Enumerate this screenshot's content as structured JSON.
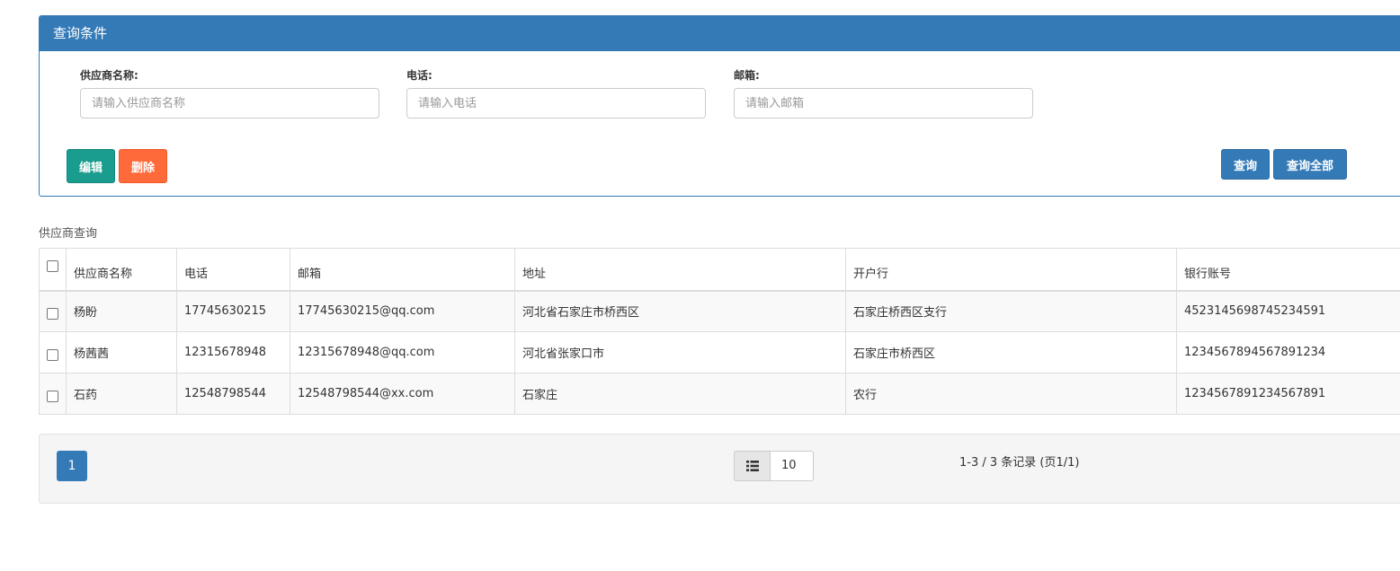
{
  "panel": {
    "title": "查询条件",
    "fields": [
      {
        "label": "供应商名称:",
        "placeholder": "请输入供应商名称",
        "value": ""
      },
      {
        "label": "电话:",
        "placeholder": "请输入电话",
        "value": ""
      },
      {
        "label": "邮箱:",
        "placeholder": "请输入邮箱",
        "value": ""
      }
    ],
    "buttons": {
      "edit": "编辑",
      "delete": "删除",
      "query": "查询",
      "query_all": "查询全部"
    }
  },
  "section_title": "供应商查询",
  "table": {
    "columns": [
      "供应商名称",
      "电话",
      "邮箱",
      "地址",
      "开户行",
      "银行账号"
    ],
    "rows": [
      [
        "杨盼",
        "17745630215",
        "17745630215@qq.com",
        "河北省石家庄市桥西区",
        "石家庄桥西区支行",
        "4523145698745234591"
      ],
      [
        "杨茜茜",
        "12315678948",
        "12315678948@qq.com",
        "河北省张家口市",
        "石家庄市桥西区",
        "1234567894567891234"
      ],
      [
        "石药",
        "12548798544",
        "12548798544@xx.com",
        "石家庄",
        "农行",
        "1234567891234567891"
      ]
    ]
  },
  "pager": {
    "current_page": "1",
    "page_size": "10",
    "size_icon": "list-icon",
    "record_info": "1-3 / 3 条记录 (页1/1)"
  },
  "colors": {
    "primary": "#337ab7",
    "edit": "#1a9c8e",
    "delete": "#ff6a3a"
  }
}
